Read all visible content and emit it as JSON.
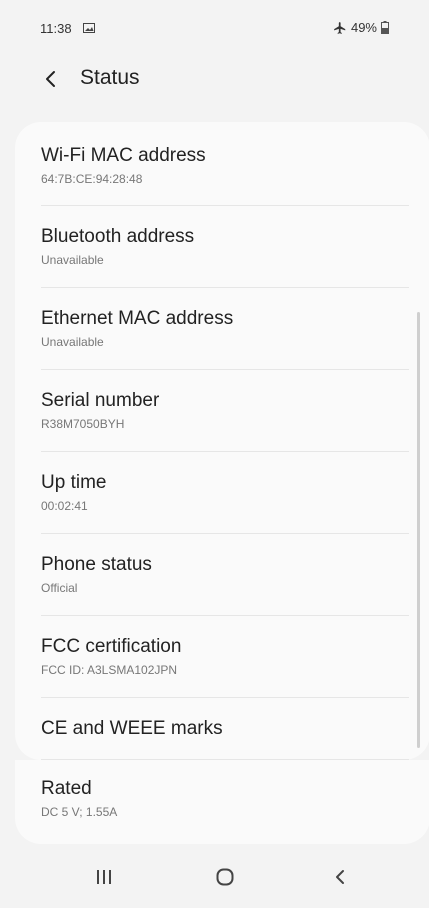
{
  "status_bar": {
    "time": "11:38",
    "battery": "49%"
  },
  "header": {
    "title": "Status"
  },
  "items": [
    {
      "title": "Wi-Fi MAC address",
      "subtitle": "64:7B:CE:94:28:48"
    },
    {
      "title": "Bluetooth address",
      "subtitle": "Unavailable"
    },
    {
      "title": "Ethernet MAC address",
      "subtitle": "Unavailable"
    },
    {
      "title": "Serial number",
      "subtitle": "R38M7050BYH"
    },
    {
      "title": "Up time",
      "subtitle": "00:02:41"
    },
    {
      "title": "Phone status",
      "subtitle": "Official"
    },
    {
      "title": "FCC certification",
      "subtitle": "FCC ID: A3LSMA102JPN"
    },
    {
      "title": "CE and WEEE marks",
      "subtitle": ""
    },
    {
      "title": "Rated",
      "subtitle": "DC 5 V; 1.55A"
    }
  ],
  "icons": {
    "status_image": "image-icon",
    "airplane": "airplane-icon",
    "battery": "battery-icon",
    "back": "back-arrow-icon",
    "nav_recent": "recent-apps-icon",
    "nav_home": "home-icon",
    "nav_back": "back-icon"
  }
}
